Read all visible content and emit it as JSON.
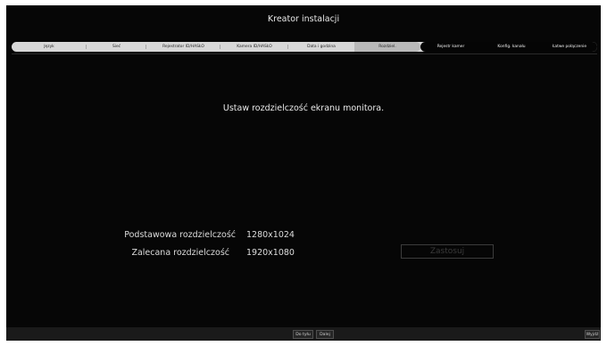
{
  "window": {
    "title": "Kreator instalacji"
  },
  "steps": [
    {
      "label": "Język"
    },
    {
      "label": "Sieć"
    },
    {
      "label": "Rejestrator ID/HASŁO"
    },
    {
      "label": "Kamera ID/HASŁO"
    },
    {
      "label": "Data i godzina"
    },
    {
      "label": "Rozdziel."
    },
    {
      "label": "Rejestr kamer"
    },
    {
      "label": "Konfig. kanału"
    },
    {
      "label": "Łatwe połączenie"
    }
  ],
  "active_step": "Rozdziel.",
  "main": {
    "heading": "Ustaw rozdzielczość ekranu monitora.",
    "basic_label": "Podstawowa rozdzielczość",
    "basic_value": "1280x1024",
    "recommended_label": "Zalecana rozdzielczość",
    "recommended_value": "1920x1080",
    "apply_label": "Zastosuj"
  },
  "footer": {
    "back_label": "Do tyłu",
    "next_label": "Dalej",
    "exit_label": "Wyjdź"
  }
}
